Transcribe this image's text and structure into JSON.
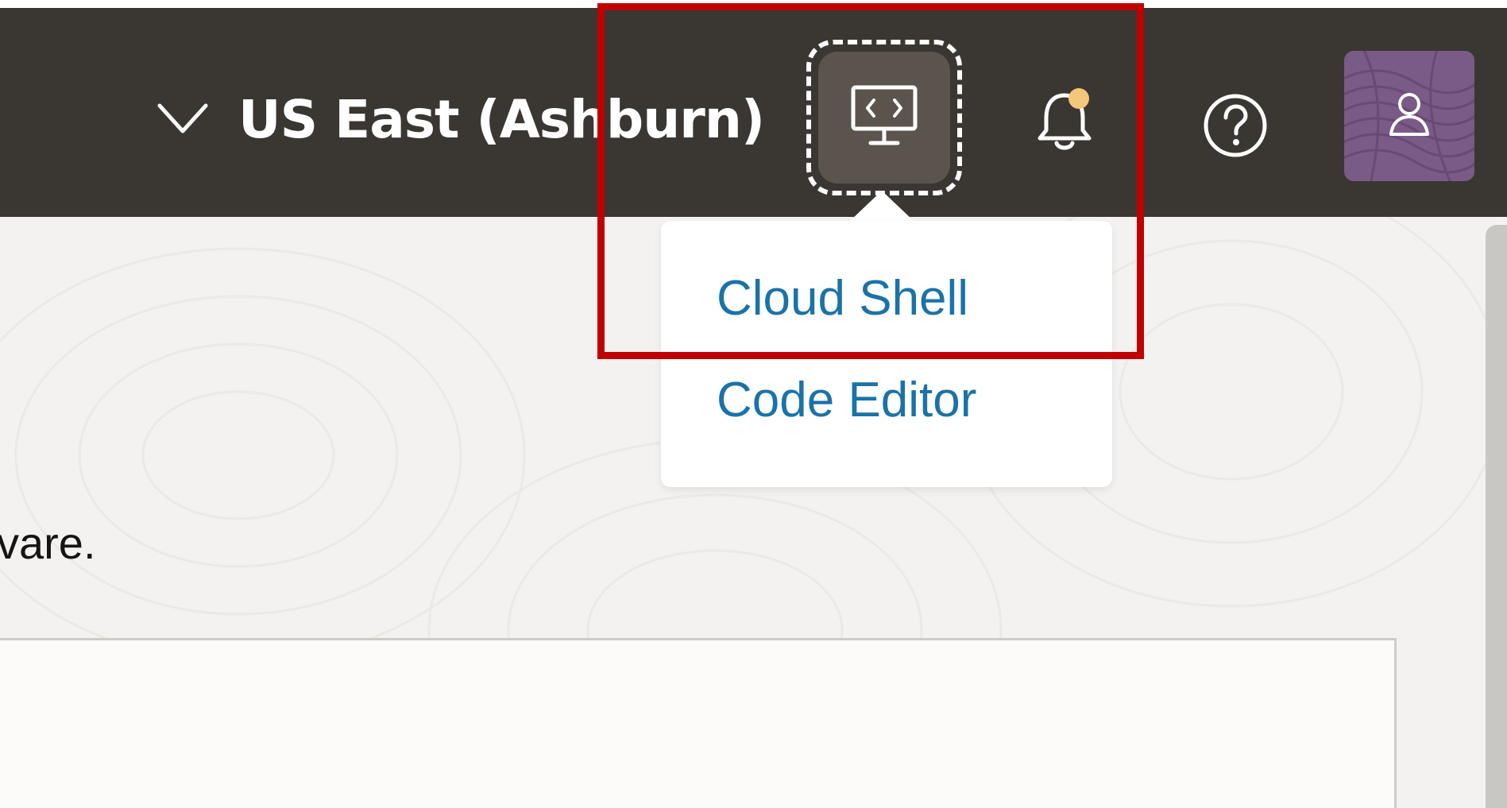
{
  "header": {
    "region": "US East (Ashburn)",
    "icons": {
      "region_dropdown": "chevron-down-icon",
      "developer_tools": "monitor-code-icon",
      "notifications": "bell-icon",
      "help": "help-circle-icon",
      "profile": "user-icon"
    },
    "notification_dot_color": "#f4c77b",
    "background_color": "#3a3631"
  },
  "developer_tools_menu": {
    "items": [
      {
        "label": "Cloud Shell"
      },
      {
        "label": "Code Editor"
      }
    ],
    "link_color": "#1a73a8"
  },
  "main": {
    "intro_text_fragment": "vare."
  },
  "annotation": {
    "highlight_color": "#c00000"
  }
}
